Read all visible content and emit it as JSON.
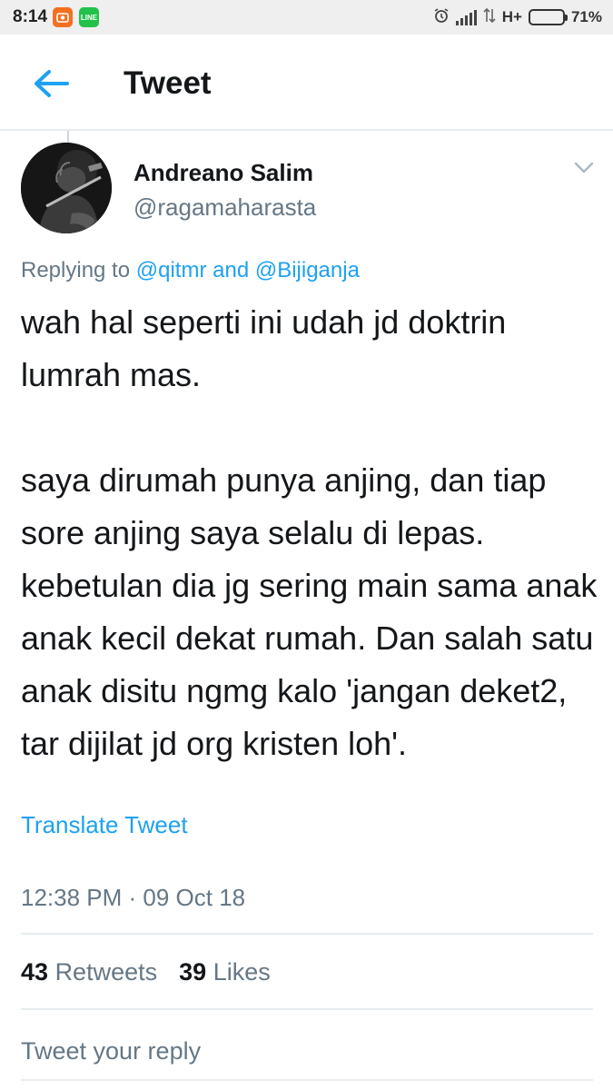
{
  "status_bar": {
    "time": "8:14",
    "app_icons": [
      {
        "name": "camera-app-icon",
        "label": "",
        "color": "#f37021"
      },
      {
        "name": "line-app-icon",
        "label": "LINE",
        "color": "#21c14a"
      }
    ],
    "network": "H+",
    "battery": "71%",
    "battery_level": 0.71
  },
  "header": {
    "title": "Tweet",
    "back_icon": "arrow-left-icon",
    "accent_color": "#1da1f2"
  },
  "tweet": {
    "author_name": "Andreano Salim",
    "author_handle": "@ragamaharasta",
    "replying_prefix": "Replying to ",
    "replying_user1": "@qitmr",
    "replying_and": " and ",
    "replying_user2": "@Bijiganja",
    "text_para1": "wah hal seperti ini udah jd doktrin lumrah mas.",
    "text_para2": "saya dirumah punya anjing, dan tiap sore anjing saya selalu di lepas. kebetulan dia jg sering main sama anak anak kecil dekat rumah. Dan salah satu anak disitu ngmg kalo 'jangan deket2, tar dijilat jd org kristen loh'.",
    "translate_label": "Translate Tweet",
    "timestamp": "12:38 PM · 09 Oct 18",
    "retweets_count": "43",
    "retweets_label": "Retweets",
    "likes_count": "39",
    "likes_label": "Likes"
  },
  "reply": {
    "placeholder": "Tweet your reply"
  }
}
